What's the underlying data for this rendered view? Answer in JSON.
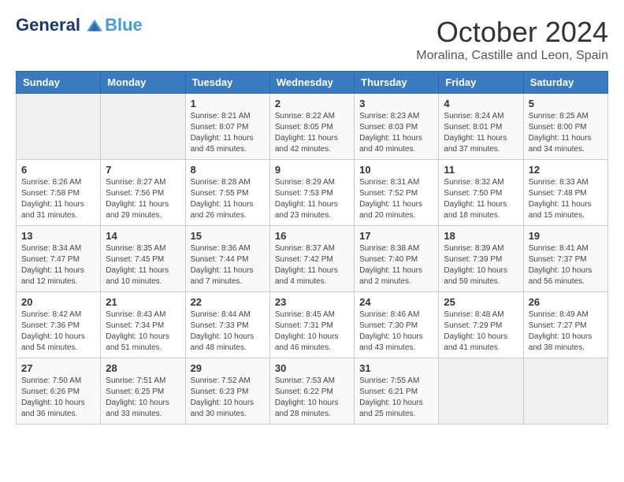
{
  "logo": {
    "line1": "General",
    "line2": "Blue"
  },
  "title": "October 2024",
  "location": "Moralina, Castille and Leon, Spain",
  "days_of_week": [
    "Sunday",
    "Monday",
    "Tuesday",
    "Wednesday",
    "Thursday",
    "Friday",
    "Saturday"
  ],
  "weeks": [
    [
      {
        "day": "",
        "info": ""
      },
      {
        "day": "",
        "info": ""
      },
      {
        "day": "1",
        "info": "Sunrise: 8:21 AM\nSunset: 8:07 PM\nDaylight: 11 hours and 45 minutes."
      },
      {
        "day": "2",
        "info": "Sunrise: 8:22 AM\nSunset: 8:05 PM\nDaylight: 11 hours and 42 minutes."
      },
      {
        "day": "3",
        "info": "Sunrise: 8:23 AM\nSunset: 8:03 PM\nDaylight: 11 hours and 40 minutes."
      },
      {
        "day": "4",
        "info": "Sunrise: 8:24 AM\nSunset: 8:01 PM\nDaylight: 11 hours and 37 minutes."
      },
      {
        "day": "5",
        "info": "Sunrise: 8:25 AM\nSunset: 8:00 PM\nDaylight: 11 hours and 34 minutes."
      }
    ],
    [
      {
        "day": "6",
        "info": "Sunrise: 8:26 AM\nSunset: 7:58 PM\nDaylight: 11 hours and 31 minutes."
      },
      {
        "day": "7",
        "info": "Sunrise: 8:27 AM\nSunset: 7:56 PM\nDaylight: 11 hours and 29 minutes."
      },
      {
        "day": "8",
        "info": "Sunrise: 8:28 AM\nSunset: 7:55 PM\nDaylight: 11 hours and 26 minutes."
      },
      {
        "day": "9",
        "info": "Sunrise: 8:29 AM\nSunset: 7:53 PM\nDaylight: 11 hours and 23 minutes."
      },
      {
        "day": "10",
        "info": "Sunrise: 8:31 AM\nSunset: 7:52 PM\nDaylight: 11 hours and 20 minutes."
      },
      {
        "day": "11",
        "info": "Sunrise: 8:32 AM\nSunset: 7:50 PM\nDaylight: 11 hours and 18 minutes."
      },
      {
        "day": "12",
        "info": "Sunrise: 8:33 AM\nSunset: 7:48 PM\nDaylight: 11 hours and 15 minutes."
      }
    ],
    [
      {
        "day": "13",
        "info": "Sunrise: 8:34 AM\nSunset: 7:47 PM\nDaylight: 11 hours and 12 minutes."
      },
      {
        "day": "14",
        "info": "Sunrise: 8:35 AM\nSunset: 7:45 PM\nDaylight: 11 hours and 10 minutes."
      },
      {
        "day": "15",
        "info": "Sunrise: 8:36 AM\nSunset: 7:44 PM\nDaylight: 11 hours and 7 minutes."
      },
      {
        "day": "16",
        "info": "Sunrise: 8:37 AM\nSunset: 7:42 PM\nDaylight: 11 hours and 4 minutes."
      },
      {
        "day": "17",
        "info": "Sunrise: 8:38 AM\nSunset: 7:40 PM\nDaylight: 11 hours and 2 minutes."
      },
      {
        "day": "18",
        "info": "Sunrise: 8:39 AM\nSunset: 7:39 PM\nDaylight: 10 hours and 59 minutes."
      },
      {
        "day": "19",
        "info": "Sunrise: 8:41 AM\nSunset: 7:37 PM\nDaylight: 10 hours and 56 minutes."
      }
    ],
    [
      {
        "day": "20",
        "info": "Sunrise: 8:42 AM\nSunset: 7:36 PM\nDaylight: 10 hours and 54 minutes."
      },
      {
        "day": "21",
        "info": "Sunrise: 8:43 AM\nSunset: 7:34 PM\nDaylight: 10 hours and 51 minutes."
      },
      {
        "day": "22",
        "info": "Sunrise: 8:44 AM\nSunset: 7:33 PM\nDaylight: 10 hours and 48 minutes."
      },
      {
        "day": "23",
        "info": "Sunrise: 8:45 AM\nSunset: 7:31 PM\nDaylight: 10 hours and 46 minutes."
      },
      {
        "day": "24",
        "info": "Sunrise: 8:46 AM\nSunset: 7:30 PM\nDaylight: 10 hours and 43 minutes."
      },
      {
        "day": "25",
        "info": "Sunrise: 8:48 AM\nSunset: 7:29 PM\nDaylight: 10 hours and 41 minutes."
      },
      {
        "day": "26",
        "info": "Sunrise: 8:49 AM\nSunset: 7:27 PM\nDaylight: 10 hours and 38 minutes."
      }
    ],
    [
      {
        "day": "27",
        "info": "Sunrise: 7:50 AM\nSunset: 6:26 PM\nDaylight: 10 hours and 36 minutes."
      },
      {
        "day": "28",
        "info": "Sunrise: 7:51 AM\nSunset: 6:25 PM\nDaylight: 10 hours and 33 minutes."
      },
      {
        "day": "29",
        "info": "Sunrise: 7:52 AM\nSunset: 6:23 PM\nDaylight: 10 hours and 30 minutes."
      },
      {
        "day": "30",
        "info": "Sunrise: 7:53 AM\nSunset: 6:22 PM\nDaylight: 10 hours and 28 minutes."
      },
      {
        "day": "31",
        "info": "Sunrise: 7:55 AM\nSunset: 6:21 PM\nDaylight: 10 hours and 25 minutes."
      },
      {
        "day": "",
        "info": ""
      },
      {
        "day": "",
        "info": ""
      }
    ]
  ]
}
